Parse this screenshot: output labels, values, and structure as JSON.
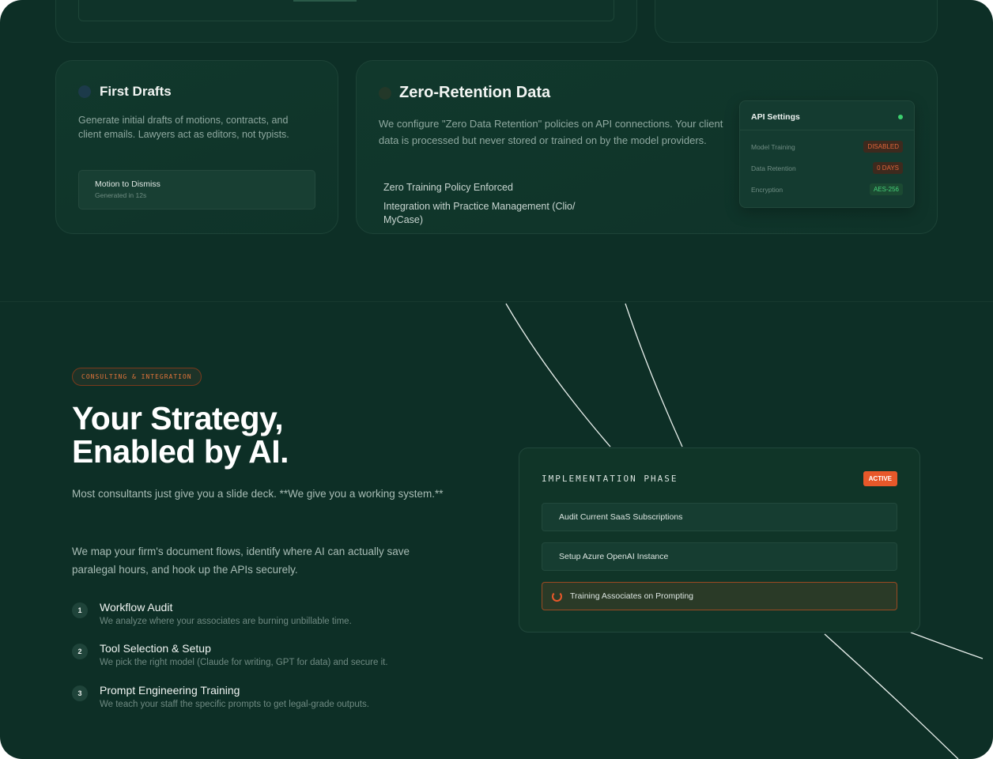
{
  "features": {
    "first_drafts": {
      "title": "First Drafts",
      "body": "Generate initial drafts of motions, contracts, and client emails. Lawyers act as editors, not typists.",
      "draft_title": "Motion to Dismiss",
      "draft_meta": "Generated in 12s"
    },
    "zero_retention": {
      "title": "Zero-Retention Data",
      "body": "We configure \"Zero Data Retention\" policies on API connections. Your client data is processed but never stored or trained on by the model providers.",
      "bullets": [
        "Zero Training Policy Enforced",
        "Integration with Practice Management (Clio/ MyCase)"
      ],
      "api": {
        "heading": "API Settings",
        "status_color": "#3ccf6e",
        "rows": [
          {
            "label": "Model Training",
            "value": "DISABLED",
            "tone": "warn"
          },
          {
            "label": "Data Retention",
            "value": "0 DAYS",
            "tone": "warn"
          },
          {
            "label": "Encryption",
            "value": "AES-256",
            "tone": "ok"
          }
        ]
      }
    }
  },
  "consulting": {
    "tag": "CONSULTING & INTEGRATION",
    "headline_line1": "Your Strategy,",
    "headline_line2": "Enabled by AI.",
    "para1": "Most consultants just give you a slide deck. **We give you a working system.**",
    "para2": "We map your firm's document flows, identify where AI can actually save paralegal hours, and hook up the APIs securely.",
    "steps": [
      {
        "num": "1",
        "title": "Workflow Audit",
        "desc": "We analyze where your associates are burning unbillable time."
      },
      {
        "num": "2",
        "title": "Tool Selection & Setup",
        "desc": "We pick the right model (Claude for writing, GPT for data) and secure it."
      },
      {
        "num": "3",
        "title": "Prompt Engineering Training",
        "desc": "We teach your staff the specific prompts to get legal-grade outputs."
      }
    ]
  },
  "implementation": {
    "label": "IMPLEMENTATION PHASE",
    "badge": "ACTIVE",
    "tasks": [
      {
        "text": "Audit Current SaaS Subscriptions",
        "active": false
      },
      {
        "text": "Setup Azure OpenAI Instance",
        "active": false
      },
      {
        "text": "Training Associates on Prompting",
        "active": true
      }
    ]
  },
  "colors": {
    "background": "#0d2f26",
    "accent": "#e8582a",
    "ok": "#3ccf6e"
  }
}
